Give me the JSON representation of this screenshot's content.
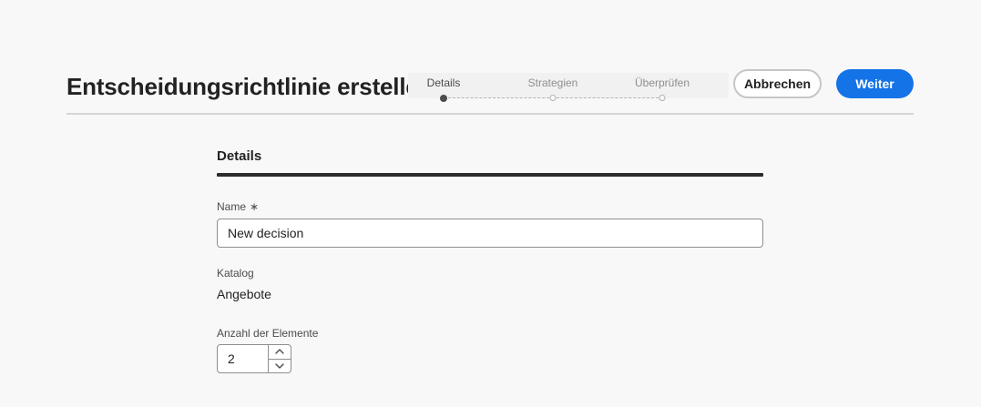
{
  "header": {
    "title": "Entscheidungsrichtlinie erstellen",
    "steps": [
      {
        "label": "Details",
        "active": true
      },
      {
        "label": "Strategien",
        "active": false
      },
      {
        "label": "Überprüfen",
        "active": false
      }
    ],
    "cancel_label": "Abbrechen",
    "next_label": "Weiter"
  },
  "form": {
    "section_title": "Details",
    "name": {
      "label": "Name",
      "required_mark": "∗",
      "value": "New decision"
    },
    "catalog": {
      "label": "Katalog",
      "value": "Angebote"
    },
    "item_count": {
      "label": "Anzahl der Elemente",
      "value": "2"
    }
  },
  "colors": {
    "primary": "#1473e6",
    "background": "#f8f8f8"
  }
}
